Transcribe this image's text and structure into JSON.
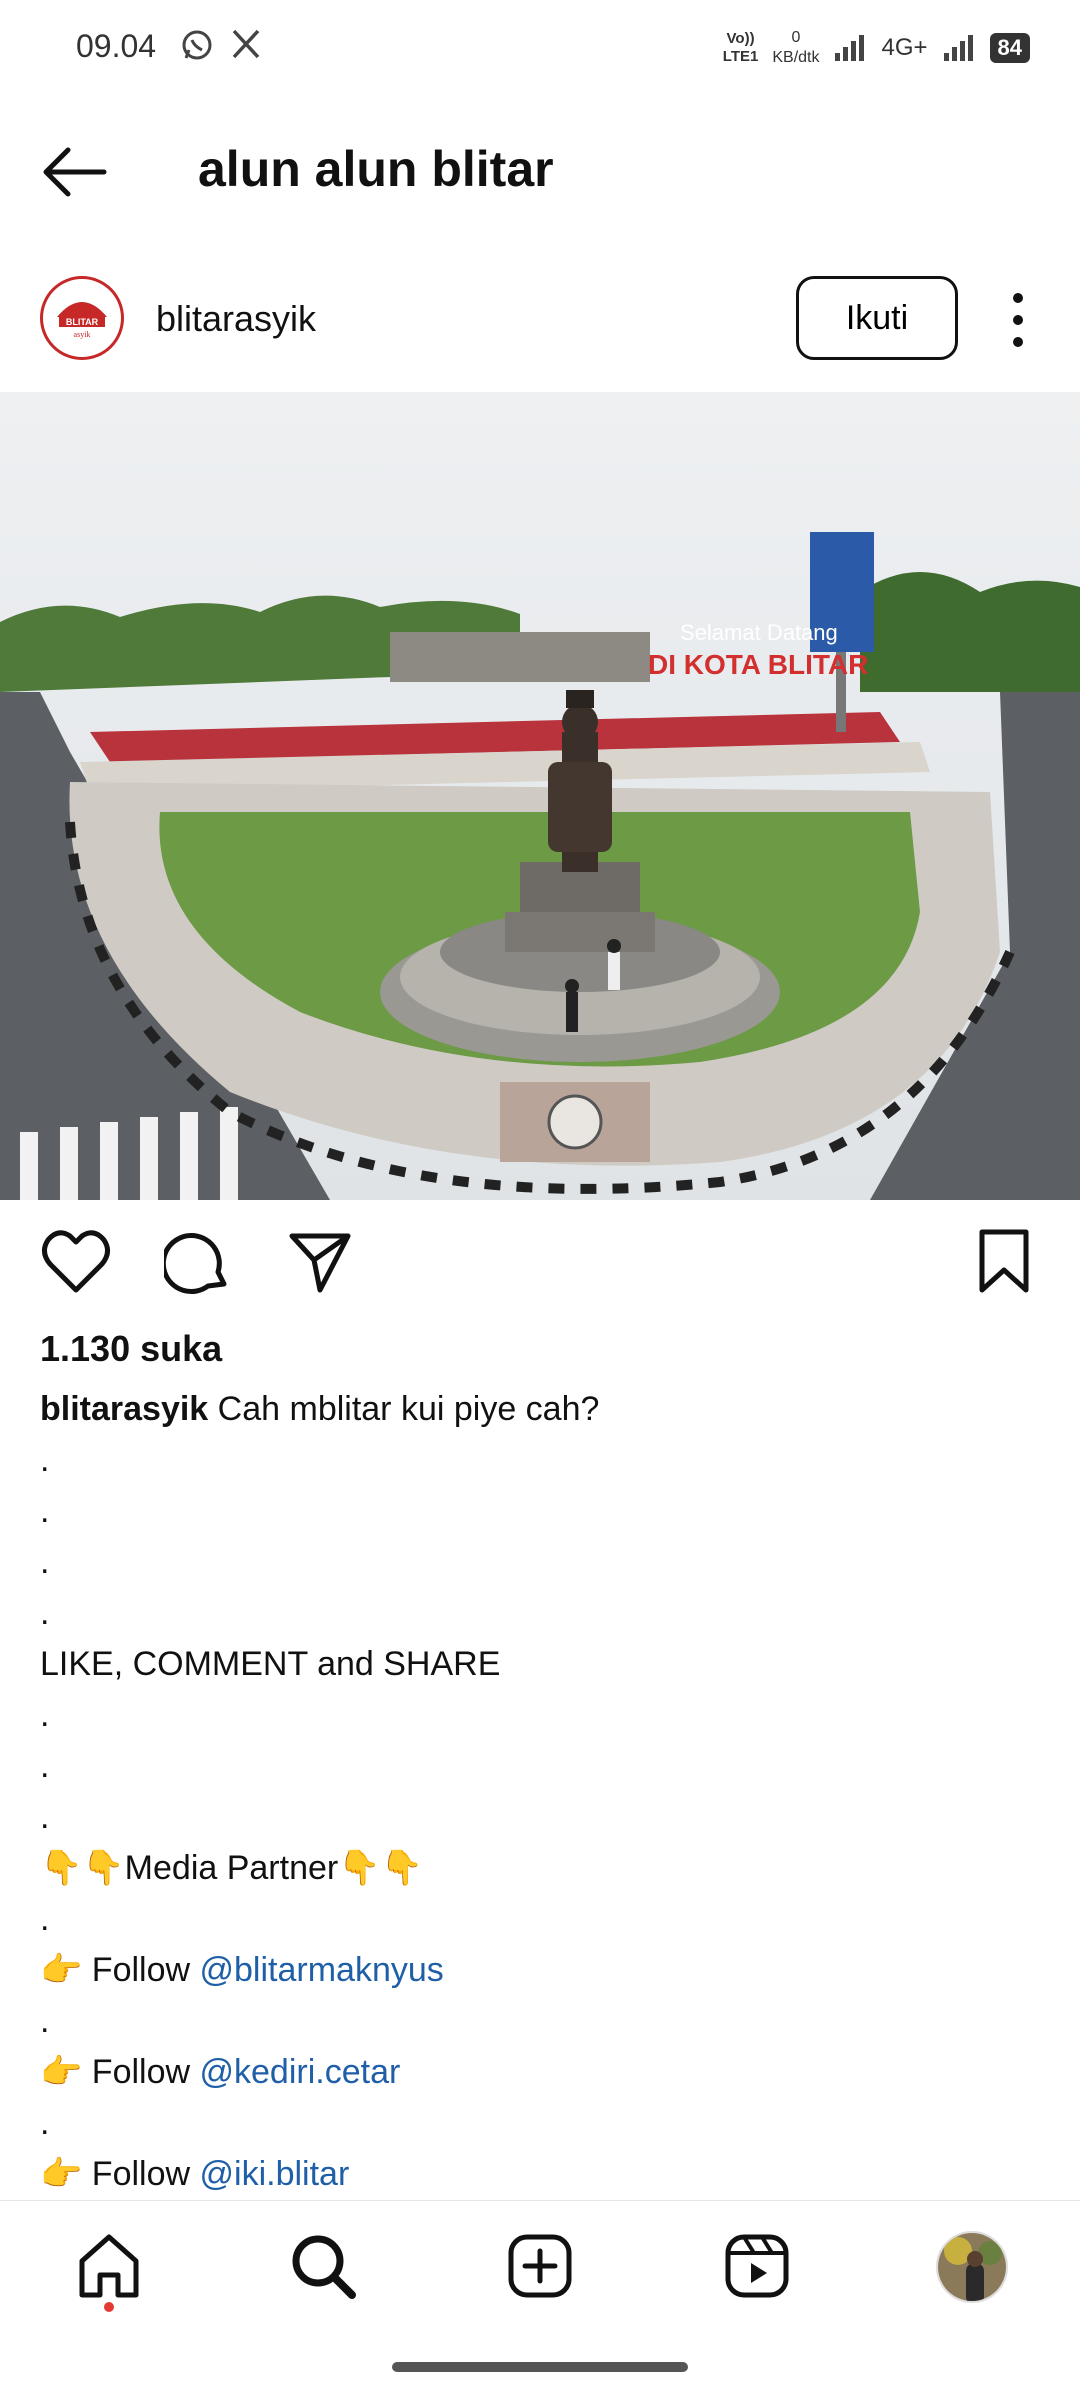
{
  "status_bar": {
    "time": "09.04",
    "net_top": "Vo))",
    "net_bottom": "LTE1",
    "speed_value": "0",
    "speed_unit": "KB/dtk",
    "network_type": "4G+",
    "battery": "84",
    "icons": [
      "whatsapp-icon",
      "x-icon",
      "signal-icon",
      "signal-icon",
      "battery-icon"
    ]
  },
  "header": {
    "title": "alun alun blitar"
  },
  "post": {
    "username": "blitarasyik",
    "follow_label": "Ikuti",
    "image_text": {
      "welcome_line1": "Selamat Datang",
      "welcome_line2": "DI KOTA BLITAR"
    },
    "likes": "1.130 suka",
    "caption_text": "Cah mblitar kui piye cah?",
    "dot": ".",
    "cta": "LIKE, COMMENT and SHARE",
    "media_partner_emoji": "👇👇",
    "media_partner": "Media Partner",
    "follow_emoji": "👉",
    "follow_word": "Follow",
    "mentions": [
      "@blitarmaknyus",
      "@kediri.cetar",
      "@iki.blitar"
    ]
  },
  "nav": {
    "items": [
      "home-icon",
      "search-icon",
      "create-icon",
      "reels-icon",
      "profile-avatar"
    ]
  },
  "colors": {
    "mention": "#1f5fa8",
    "accent_red": "#c62828"
  }
}
